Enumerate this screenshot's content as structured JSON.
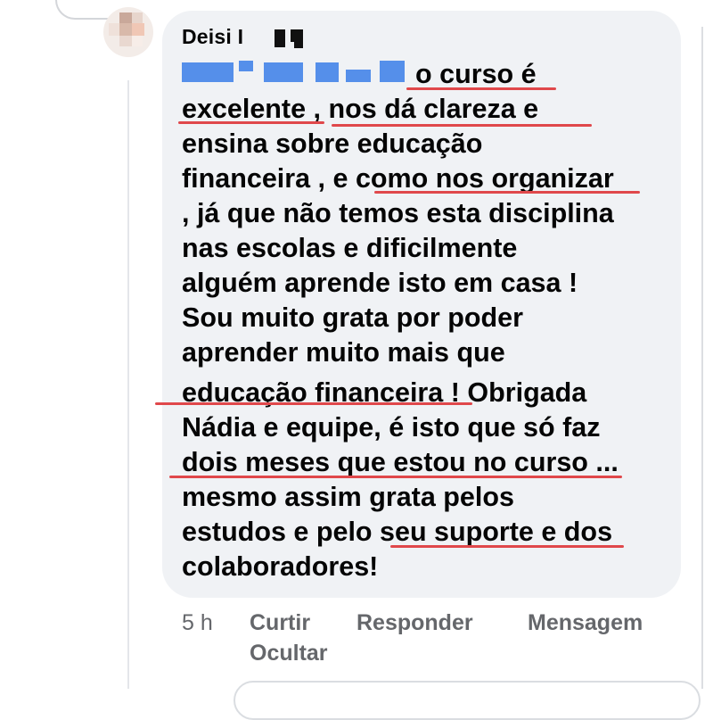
{
  "comment": {
    "author": "Deisi I",
    "lines": [
      "o curso é",
      "excelente , nos dá clareza e",
      "ensina sobre educação",
      "financeira , e como nos organizar",
      ", já que não temos esta disciplina",
      "nas escolas e dificilmente",
      "alguém aprende isto em casa !",
      "Sou muito grata por poder",
      "aprender muito mais que",
      "educação financeira ! Obrigada",
      "Nádia e equipe, é isto que só faz",
      "dois meses que estou no curso ...",
      "mesmo assim grata pelos",
      "estudos e pelo seu suporte e dos",
      "colaboradores!"
    ],
    "highlight_color": "#e0484b"
  },
  "actions": {
    "time": "5 h",
    "like": "Curtir",
    "reply": "Responder",
    "message": "Mensagem",
    "hide": "Ocultar"
  },
  "colors": {
    "bubble": "#f0f2f5",
    "text": "#050505",
    "meta": "#65676b"
  }
}
